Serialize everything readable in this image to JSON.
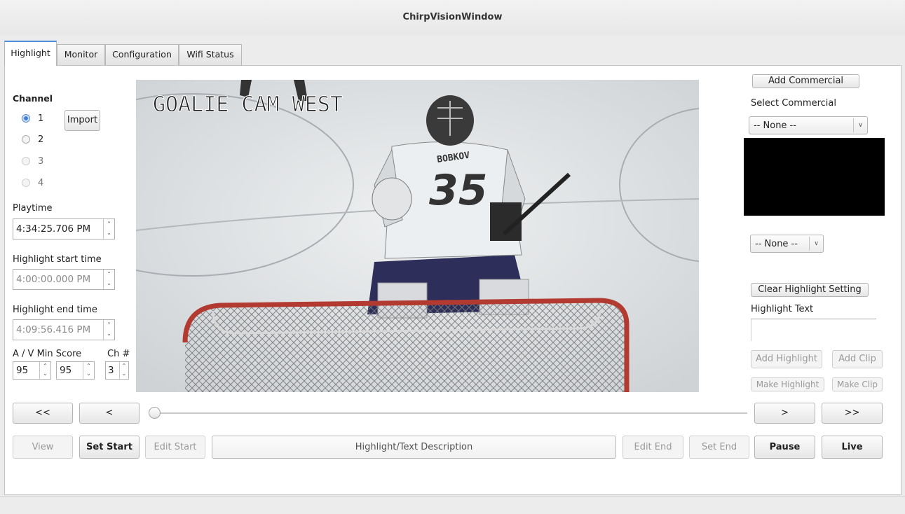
{
  "window": {
    "title": "ChirpVisionWindow"
  },
  "tabs": [
    {
      "label": "Highlight"
    },
    {
      "label": "Monitor"
    },
    {
      "label": "Configuration"
    },
    {
      "label": "Wifi Status"
    }
  ],
  "left": {
    "channel_label": "Channel",
    "channels": [
      "1",
      "2",
      "3",
      "4"
    ],
    "selected_channel": "1",
    "import_label": "Import",
    "playtime_label": "Playtime",
    "playtime_value": "4:34:25.706 PM",
    "start_label": "Highlight start time",
    "start_value": "4:00:00.000 PM",
    "end_label": "Highlight end time",
    "end_value": "4:09:56.416 PM",
    "score_label": "A / V Min Score",
    "ch_label": "Ch #",
    "a_score": "95",
    "v_score": "95",
    "ch_num": "3"
  },
  "video": {
    "overlay_text": "GOALIE CAM WEST",
    "jersey_name": "BOBKOV",
    "jersey_number": "35"
  },
  "right": {
    "add_commercial": "Add Commercial",
    "select_commercial_label": "Select Commercial",
    "commercial_select": "-- None --",
    "second_select": "-- None --",
    "clear_highlight": "Clear Highlight Setting",
    "highlight_text_label": "Highlight Text",
    "highlight_text_value": "",
    "add_highlight": "Add Highlight",
    "add_clip": "Add Clip",
    "make_highlight": "Make Highlight",
    "make_clip": "Make Clip"
  },
  "nav": {
    "rewind_fast": "<<",
    "rewind": "<",
    "forward": ">",
    "forward_fast": ">>"
  },
  "bottom": {
    "view": "View",
    "set_start": "Set Start",
    "edit_start": "Edit Start",
    "description_placeholder": "Highlight/Text Description",
    "edit_end": "Edit End",
    "set_end": "Set End",
    "pause": "Pause",
    "live": "Live"
  },
  "colors": {
    "accent": "#4a90d9",
    "radio_selected": "#3d7bd9",
    "preview_bg": "#000000"
  },
  "slider": {
    "position_fraction": 0.0
  }
}
